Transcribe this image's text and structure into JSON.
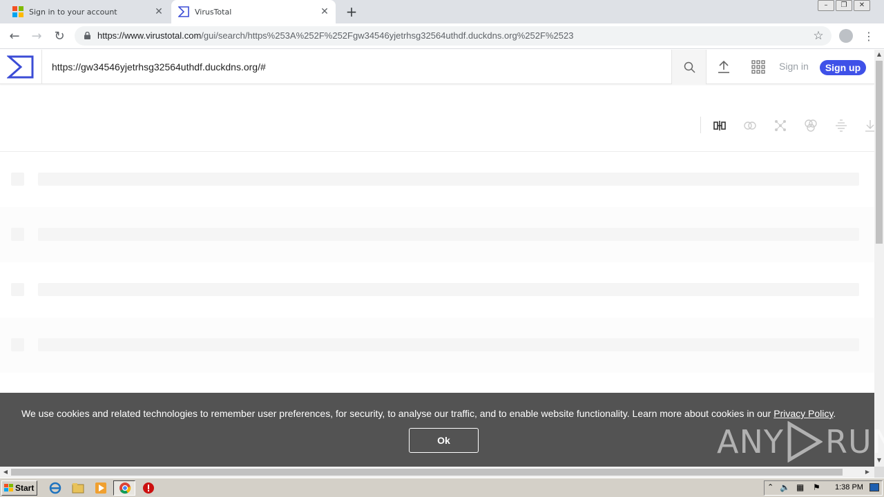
{
  "browser": {
    "tabs": [
      {
        "title": "Sign in to your account",
        "favicon": "microsoft-logo-icon",
        "active": false
      },
      {
        "title": "VirusTotal",
        "favicon": "virustotal-logo-icon",
        "active": true
      }
    ],
    "url_domain": "https://www.virustotal.com",
    "url_path": "/gui/search/https%253A%252F%252Fgw34546yjetrhsg32564uthdf.duckdns.org%252F%2523"
  },
  "vt": {
    "search_value": "https://gw34546yjetrhsg32564uthdf.duckdns.org/#",
    "signin_label": "Sign in",
    "signup_label": "Sign up",
    "accent": "#3f51e8"
  },
  "cookie_banner": {
    "message": "We use cookies and related technologies to remember user preferences, for security, to analyse our traffic, and to enable website functionality. Learn more about cookies in our ",
    "link": "Privacy Policy",
    "trailing": ".",
    "ok_label": "Ok"
  },
  "watermark": {
    "left": "ANY",
    "right": "RUN"
  },
  "taskbar": {
    "start_label": "Start",
    "time": "1:38 PM"
  }
}
